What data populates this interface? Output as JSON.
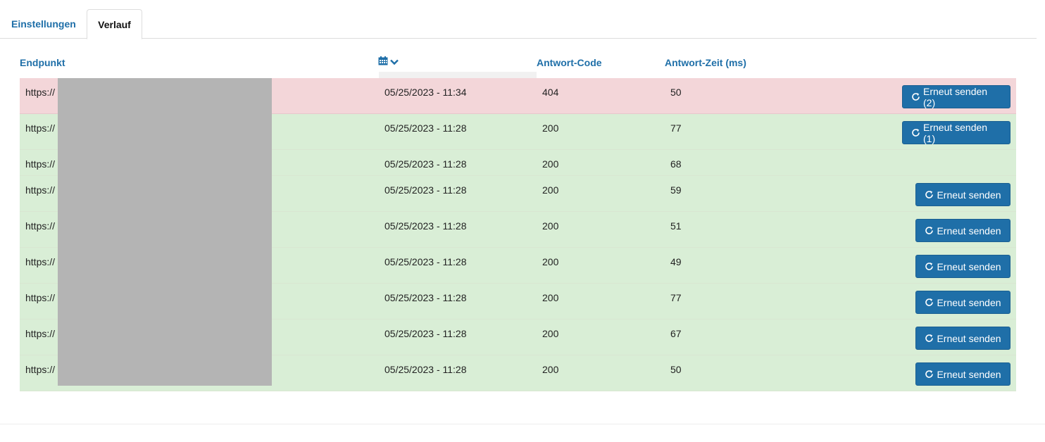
{
  "tabs": [
    {
      "label": "Einstellungen",
      "active": false
    },
    {
      "label": "Verlauf",
      "active": true
    }
  ],
  "table": {
    "headers": {
      "endpoint": "Endpunkt",
      "date_icon": "calendar-icon",
      "code": "Antwort-Code",
      "time": "Antwort-Zeit (ms)"
    },
    "rows": [
      {
        "url": "https://",
        "date": "05/25/2023 - 11:34",
        "code": "404",
        "time": "50",
        "status": "error",
        "button": "Erneut senden (2)"
      },
      {
        "url": "https://",
        "date": "05/25/2023 - 11:28",
        "code": "200",
        "time": "77",
        "status": "ok",
        "button": "Erneut senden (1)"
      },
      {
        "url": "https://",
        "date": "05/25/2023 - 11:28",
        "code": "200",
        "time": "68",
        "status": "ok",
        "button": null
      },
      {
        "url": "https://",
        "date": "05/25/2023 - 11:28",
        "code": "200",
        "time": "59",
        "status": "ok",
        "button": "Erneut senden"
      },
      {
        "url": "https://",
        "date": "05/25/2023 - 11:28",
        "code": "200",
        "time": "51",
        "status": "ok",
        "button": "Erneut senden"
      },
      {
        "url": "https://",
        "date": "05/25/2023 - 11:28",
        "code": "200",
        "time": "49",
        "status": "ok",
        "button": "Erneut senden"
      },
      {
        "url": "https://",
        "date": "05/25/2023 - 11:28",
        "code": "200",
        "time": "77",
        "status": "ok",
        "button": "Erneut senden"
      },
      {
        "url": "https://",
        "date": "05/25/2023 - 11:28",
        "code": "200",
        "time": "67",
        "status": "ok",
        "button": "Erneut senden"
      },
      {
        "url": "https://",
        "date": "05/25/2023 - 11:28",
        "code": "200",
        "time": "50",
        "status": "ok",
        "button": "Erneut senden"
      }
    ]
  },
  "colors": {
    "accent": "#1f6fa8",
    "row_ok": "#d9eed6",
    "row_error": "#f3d6d9",
    "redaction": "#b4b4b4"
  },
  "icons": {
    "resend": "refresh-icon",
    "sort": "chevron-down-icon"
  }
}
